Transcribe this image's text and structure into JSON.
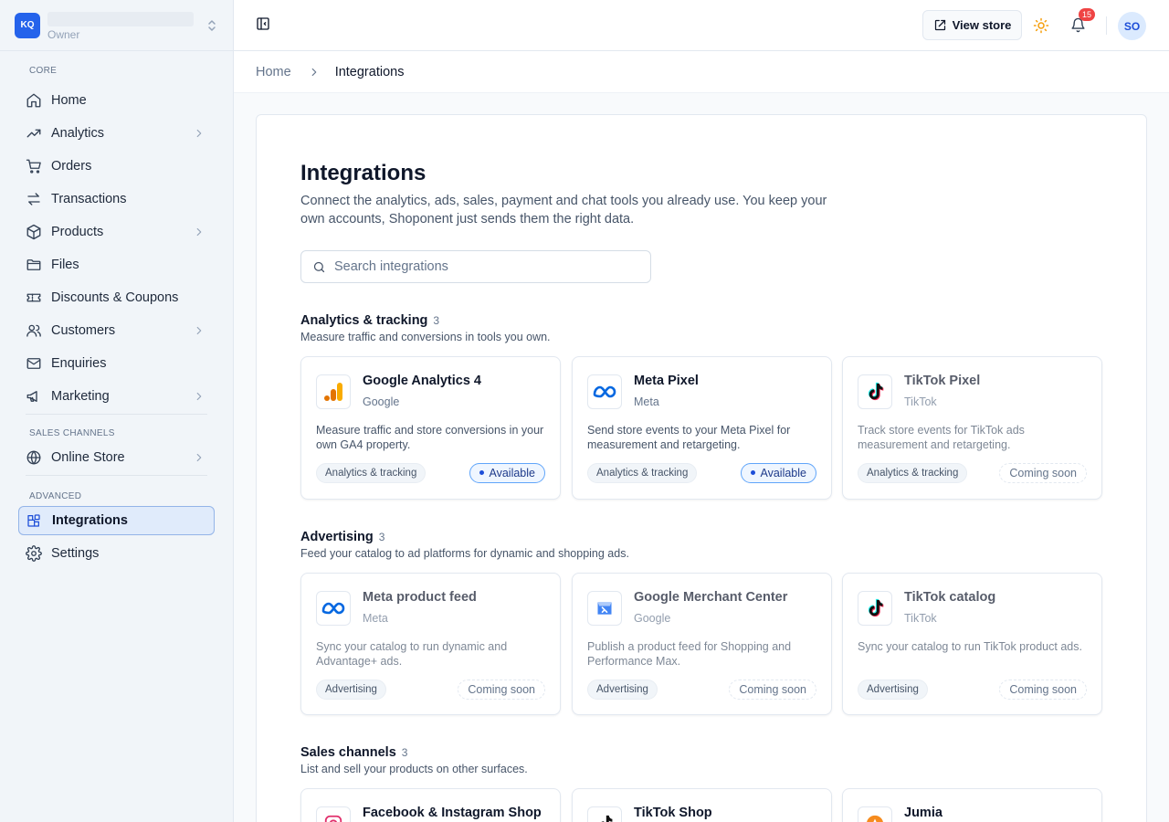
{
  "org": {
    "initials": "KQ",
    "role": "Owner"
  },
  "sidebar": {
    "sections": [
      {
        "label": "CORE"
      },
      {
        "label": "SALES CHANNELS"
      },
      {
        "label": "ADVANCED"
      }
    ],
    "items": [
      {
        "label": "Home",
        "icon": "home-icon"
      },
      {
        "label": "Analytics",
        "icon": "trending-up-icon"
      },
      {
        "label": "Orders",
        "icon": "cart-icon"
      },
      {
        "label": "Transactions",
        "icon": "arrows-swap-icon"
      },
      {
        "label": "Products",
        "icon": "box-icon"
      },
      {
        "label": "Files",
        "icon": "folder-icon"
      },
      {
        "label": "Discounts & Coupons",
        "icon": "ticket-icon"
      },
      {
        "label": "Customers",
        "icon": "users-icon"
      },
      {
        "label": "Enquiries",
        "icon": "mail-icon"
      },
      {
        "label": "Marketing",
        "icon": "megaphone-icon"
      },
      {
        "label": "Online Store",
        "icon": "globe-icon"
      },
      {
        "label": "Integrations",
        "icon": "grid-plus-icon"
      },
      {
        "label": "Settings",
        "icon": "gear-icon"
      }
    ]
  },
  "topbar": {
    "view_store": "View store",
    "notifications_count": "15",
    "avatar_initials": "SO"
  },
  "breadcrumb": {
    "home": "Home",
    "current": "Integrations"
  },
  "page": {
    "title": "Integrations",
    "description": "Connect the analytics, ads, sales, payment and chat tools you already use. You keep your own accounts, Shoponent just sends them the right data.",
    "search_placeholder": "Search integrations"
  },
  "sections": [
    {
      "title": "Analytics & tracking",
      "count": "3",
      "subtitle": "Measure traffic and conversions in tools you own.",
      "cards": [
        {
          "name": "Google Analytics 4",
          "vendor": "Google",
          "description": "Measure traffic and store conversions in your own GA4 property.",
          "tag": "Analytics & tracking",
          "status": "Available",
          "icon": "google-analytics-icon"
        },
        {
          "name": "Meta Pixel",
          "vendor": "Meta",
          "description": "Send store events to your Meta Pixel for measurement and retargeting.",
          "tag": "Analytics & tracking",
          "status": "Available",
          "icon": "meta-icon"
        },
        {
          "name": "TikTok Pixel",
          "vendor": "TikTok",
          "description": "Track store events for TikTok ads measurement and retargeting.",
          "tag": "Analytics & tracking",
          "status": "Coming soon",
          "icon": "tiktok-icon"
        }
      ]
    },
    {
      "title": "Advertising",
      "count": "3",
      "subtitle": "Feed your catalog to ad platforms for dynamic and shopping ads.",
      "cards": [
        {
          "name": "Meta product feed",
          "vendor": "Meta",
          "description": "Sync your catalog to run dynamic and Advantage+ ads.",
          "tag": "Advertising",
          "status": "Coming soon",
          "icon": "meta-icon"
        },
        {
          "name": "Google Merchant Center",
          "vendor": "Google",
          "description": "Publish a product feed for Shopping and Performance Max.",
          "tag": "Advertising",
          "status": "Coming soon",
          "icon": "google-merchant-icon"
        },
        {
          "name": "TikTok catalog",
          "vendor": "TikTok",
          "description": "Sync your catalog to run TikTok product ads.",
          "tag": "Advertising",
          "status": "Coming soon",
          "icon": "tiktok-icon"
        }
      ]
    },
    {
      "title": "Sales channels",
      "count": "3",
      "subtitle": "List and sell your products on other surfaces.",
      "cards": [
        {
          "name": "Facebook & Instagram Shop",
          "icon": "instagram-icon"
        },
        {
          "name": "TikTok Shop",
          "icon": "tiktok-icon"
        },
        {
          "name": "Jumia",
          "icon": "jumia-icon"
        }
      ]
    }
  ],
  "colors": {
    "accent": "#2563eb",
    "available_border": "#60a5fa",
    "badge": "#ef4444"
  }
}
